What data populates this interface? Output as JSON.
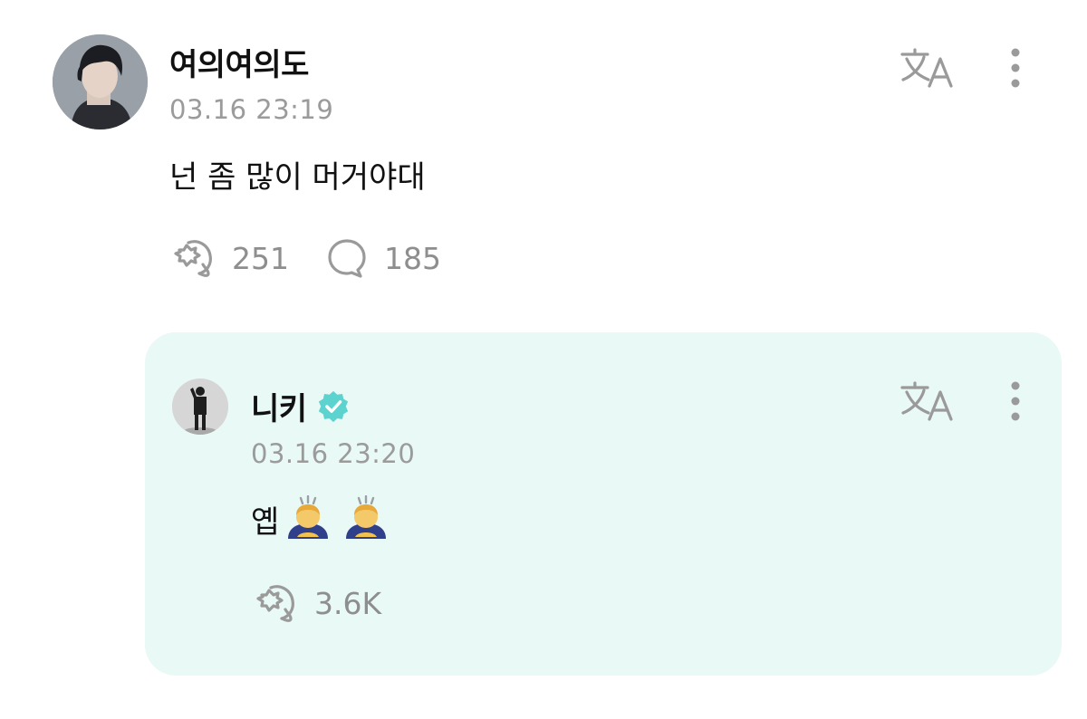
{
  "fan_comment": {
    "username": "여의여의도",
    "timestamp": "03.16 23:19",
    "text": "넌 좀 많이 머거야대",
    "likes": "251",
    "replies": "185",
    "icons": {
      "avatar": "profile-photo",
      "translate": "translate-icon",
      "more": "more-vertical-icon",
      "like": "like-icon",
      "reply": "comment-bubble-icon"
    }
  },
  "artist_reply": {
    "username": "니키",
    "timestamp": "03.16 23:20",
    "text": "옙",
    "emojis": [
      "🙇",
      "🙇"
    ],
    "likes": "3.6K",
    "verified": true,
    "icons": {
      "avatar": "profile-photo",
      "verified": "verified-badge-icon",
      "translate": "translate-icon",
      "more": "more-vertical-icon",
      "like": "like-icon"
    }
  },
  "colors": {
    "reply_background": "#e9f9f6",
    "verified_badge": "#5dd3cf",
    "muted_text": "#9b9b9b",
    "icon_gray": "#9a9a9a"
  }
}
